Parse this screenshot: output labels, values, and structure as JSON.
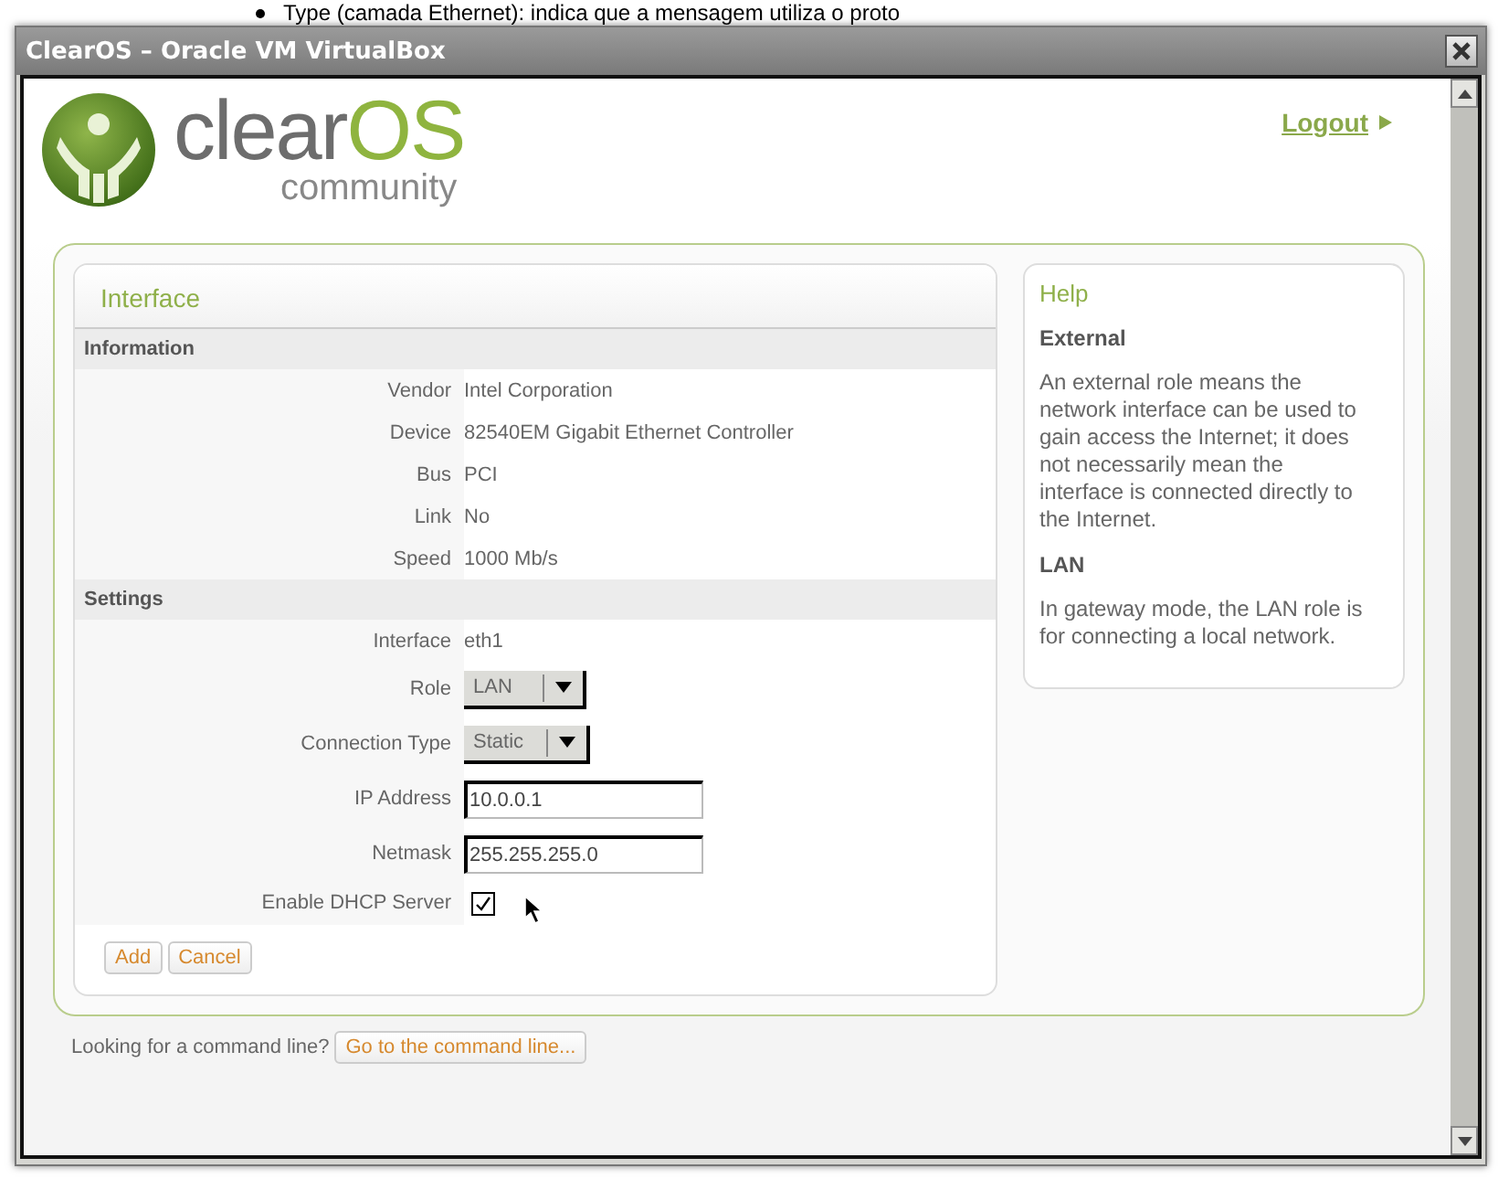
{
  "document_behind": {
    "text": "Type (camada Ethernet): indica que a mensagem utiliza o proto"
  },
  "window": {
    "title": "ClearOS – Oracle VM VirtualBox"
  },
  "header": {
    "logo": {
      "name_part1": "clear",
      "name_part2": "OS",
      "tagline": "community"
    },
    "logout": "Logout"
  },
  "interface_card": {
    "title": "Interface",
    "sections": [
      {
        "title": "Information",
        "rows": [
          {
            "kind": "text",
            "label": "Vendor",
            "value": "Intel Corporation"
          },
          {
            "kind": "text",
            "label": "Device",
            "value": "82540EM Gigabit Ethernet Controller"
          },
          {
            "kind": "text",
            "label": "Bus",
            "value": "PCI"
          },
          {
            "kind": "text",
            "label": "Link",
            "value": "No"
          },
          {
            "kind": "text",
            "label": "Speed",
            "value": "1000 Mb/s"
          }
        ]
      },
      {
        "title": "Settings",
        "rows": [
          {
            "kind": "text",
            "label": "Interface",
            "value": "eth1"
          },
          {
            "kind": "select",
            "label": "Role",
            "value": "LAN"
          },
          {
            "kind": "select",
            "label": "Connection Type",
            "value": "Static"
          },
          {
            "kind": "input",
            "label": "IP Address",
            "value": "10.0.0.1"
          },
          {
            "kind": "input",
            "label": "Netmask",
            "value": "255.255.255.0"
          },
          {
            "kind": "checkbox",
            "label": "Enable DHCP Server",
            "checked": true
          }
        ]
      }
    ],
    "buttons": [
      "Add",
      "Cancel"
    ]
  },
  "help": {
    "title": "Help",
    "sections": [
      {
        "heading": "External",
        "text": "An external role means the network interface can be used to gain access the Internet; it does not necessarily mean the interface is connected directly to the Internet."
      },
      {
        "heading": "LAN",
        "text": "In gateway mode, the LAN role is for connecting a local network."
      }
    ]
  },
  "footer": {
    "text": "Looking for a command line?",
    "button": "Go to the command line..."
  }
}
